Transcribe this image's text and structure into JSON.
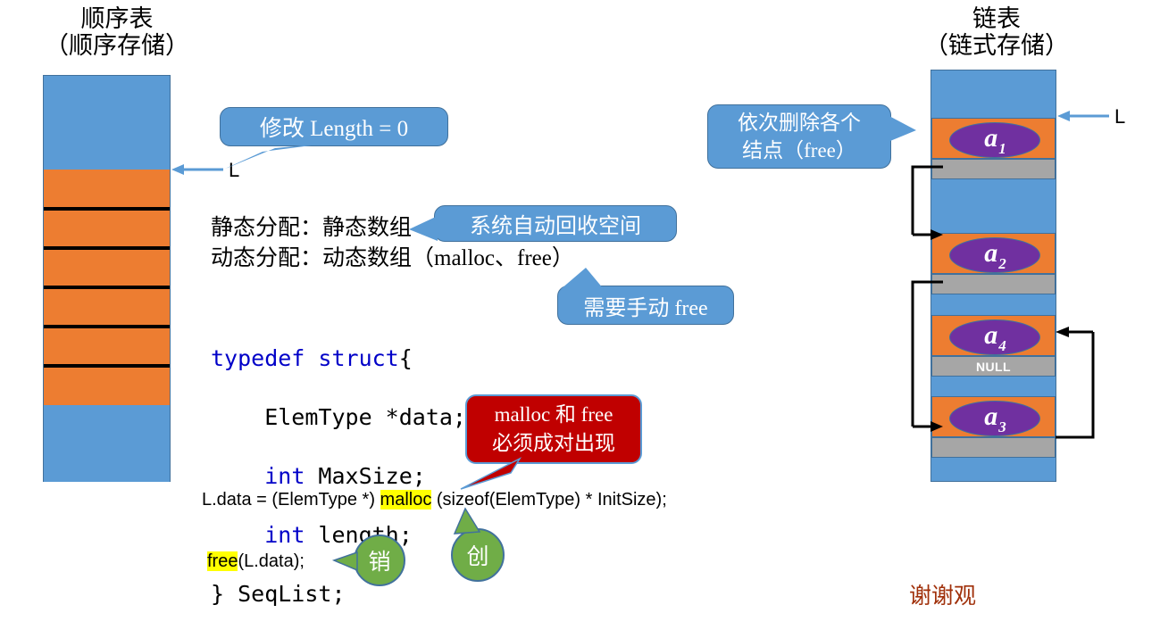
{
  "left_panel": {
    "title_line1": "顺序表",
    "title_line2": "（顺序存储）",
    "pointer_label": "L",
    "callout": {
      "text": "修改 Length = 0"
    }
  },
  "right_panel": {
    "title_line1": "链表",
    "title_line2": "（链式存储）",
    "pointer_label": "L",
    "callout": {
      "line1": "依次删除各个",
      "line2": "结点（free）"
    },
    "nodes": [
      {
        "name": "a",
        "index": "1",
        "pointer_text": ""
      },
      {
        "name": "a",
        "index": "2",
        "pointer_text": ""
      },
      {
        "name": "a",
        "index": "4",
        "pointer_text": "NULL"
      },
      {
        "name": "a",
        "index": "3",
        "pointer_text": ""
      }
    ]
  },
  "middle": {
    "alloc_static": "静态分配：静态数组",
    "alloc_dynamic": "动态分配：动态数组（malloc、free）",
    "callout_auto_free": "系统自动回收空间",
    "callout_manual_free": "需要手动 free",
    "callout_pair": {
      "line1": "malloc 和 free",
      "line2": "必须成对出现"
    },
    "code": {
      "line1_kw": "typedef struct",
      "line1_rest": "{",
      "line2": "    ElemType *data;",
      "line3_kw": "int",
      "line3_rest": " MaxSize;",
      "line4_kw": "int",
      "line4_rest": " length;",
      "line5": "} SeqList;"
    },
    "malloc_line": {
      "prefix": "L.data = (ElemType *) ",
      "highlight": "malloc",
      "suffix": " (sizeof(ElemType) * InitSize);"
    },
    "free_line": {
      "highlight": "free",
      "suffix": "(L.data);"
    },
    "bubble_destroy": "销",
    "bubble_create": "创"
  },
  "bottom_note": "谢谢观",
  "colors": {
    "blue": "#5B9BD5",
    "orange": "#ED7D31",
    "gray": "#A6A6A6",
    "purple": "#7030A0",
    "red": "#C00000",
    "green": "#70AD47",
    "highlight": "#FFFF00",
    "keyword": "#0000C8",
    "border": "#41719C"
  }
}
